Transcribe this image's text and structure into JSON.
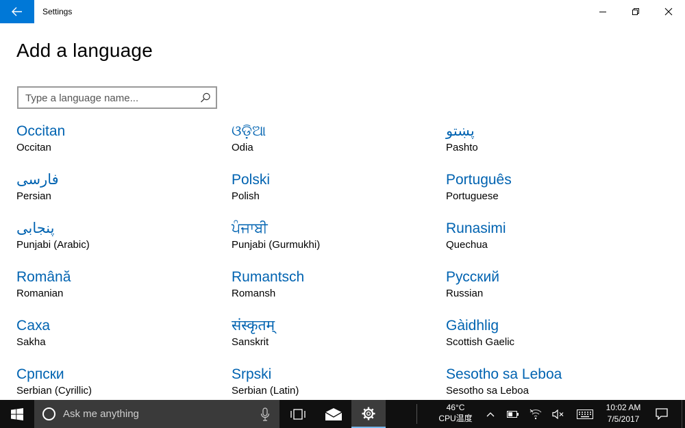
{
  "window": {
    "app_title": "Settings",
    "controls": {
      "minimize_icon": "minimize-icon",
      "restore_icon": "restore-icon",
      "close_icon": "close-icon"
    }
  },
  "page": {
    "title": "Add a language",
    "search": {
      "placeholder": "Type a language name...",
      "value": ""
    }
  },
  "languages": [
    {
      "native": "Occitan",
      "english": "Occitan"
    },
    {
      "native": "ଓଡ଼ିଆ",
      "english": "Odia"
    },
    {
      "native": "پښتو",
      "english": "Pashto"
    },
    {
      "native": "فارسی",
      "english": "Persian"
    },
    {
      "native": "Polski",
      "english": "Polish"
    },
    {
      "native": "Português",
      "english": "Portuguese"
    },
    {
      "native": "پنجابی",
      "english": "Punjabi (Arabic)"
    },
    {
      "native": "ਪੰਜਾਬੀ",
      "english": "Punjabi (Gurmukhi)"
    },
    {
      "native": "Runasimi",
      "english": "Quechua"
    },
    {
      "native": "Română",
      "english": "Romanian"
    },
    {
      "native": "Rumantsch",
      "english": "Romansh"
    },
    {
      "native": "Русский",
      "english": "Russian"
    },
    {
      "native": "Саха",
      "english": "Sakha"
    },
    {
      "native": "संस्कृतम्",
      "english": "Sanskrit"
    },
    {
      "native": "Gàidhlig",
      "english": "Scottish Gaelic"
    },
    {
      "native": "Српски",
      "english": "Serbian (Cyrillic)"
    },
    {
      "native": "Srpski",
      "english": "Serbian (Latin)"
    },
    {
      "native": "Sesotho sa Leboa",
      "english": "Sesotho sa Leboa"
    }
  ],
  "taskbar": {
    "search_placeholder": "Ask me anything",
    "temperature": "46°C",
    "cpu_label": "CPU温度",
    "time": "10:02 AM",
    "date": "7/5/2017"
  },
  "colors": {
    "accent": "#0078d7",
    "link": "#0063b1",
    "taskbar": "#101010"
  }
}
